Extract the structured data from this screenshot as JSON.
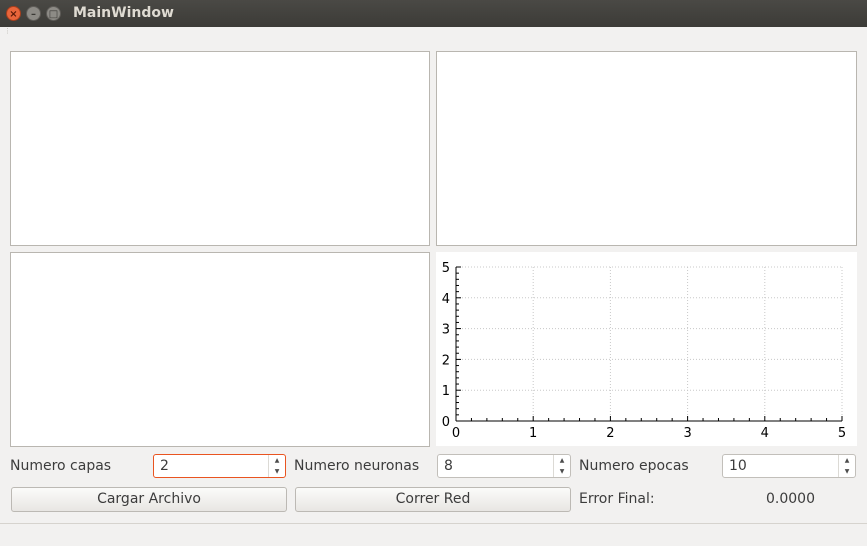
{
  "window": {
    "title": "MainWindow"
  },
  "chart_data": {
    "type": "scatter",
    "x_ticks": [
      "0",
      "1",
      "2",
      "3",
      "4",
      "5"
    ],
    "y_ticks": [
      "0",
      "1",
      "2",
      "3",
      "4",
      "5"
    ],
    "xlim": [
      0,
      5
    ],
    "ylim": [
      0,
      5
    ],
    "grid": true,
    "series": []
  },
  "controls": {
    "capas_label": "Numero capas",
    "capas_value": "2",
    "neuronas_label": "Numero neuronas",
    "neuronas_value": "8",
    "epocas_label": "Numero epocas",
    "epocas_value": "10",
    "cargar_label": "Cargar Archivo",
    "correr_label": "Correr Red",
    "error_label": "Error Final:",
    "error_value": "0.0000"
  }
}
